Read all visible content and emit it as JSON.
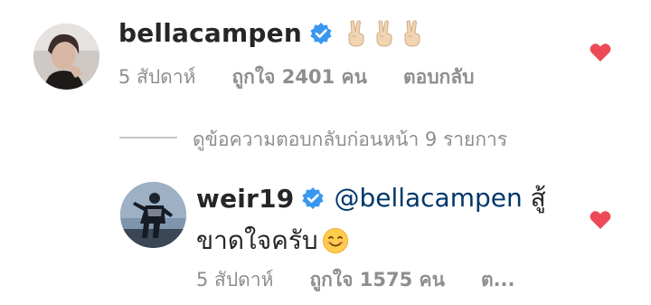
{
  "comment": {
    "username": "bellacampen",
    "text_emoji": [
      "victory-hand-emoji",
      "victory-hand-emoji",
      "victory-hand-emoji"
    ],
    "time": "5 สัปดาห์",
    "likes": "ถูกใจ 2401 คน",
    "reply_label": "ตอบกลับ",
    "liked": true
  },
  "view_replies": "ดูข้อความตอบกลับก่อนหน้า 9 รายการ",
  "reply": {
    "username": "weir19",
    "mention": "@bellacampen",
    "text_line1": "สู้",
    "text_line2": "ขาดใจครับ",
    "text_emoji": "smiling-face-emoji",
    "time": "5 สัปดาห์",
    "likes": "ถูกใจ 1575 คน",
    "reply_label": "ต...",
    "liked": true
  },
  "colors": {
    "heart": "#ed4956",
    "verified": "#3897f0",
    "mention": "#00376b",
    "meta_text": "#8e8e8e",
    "primary_text": "#262626"
  }
}
